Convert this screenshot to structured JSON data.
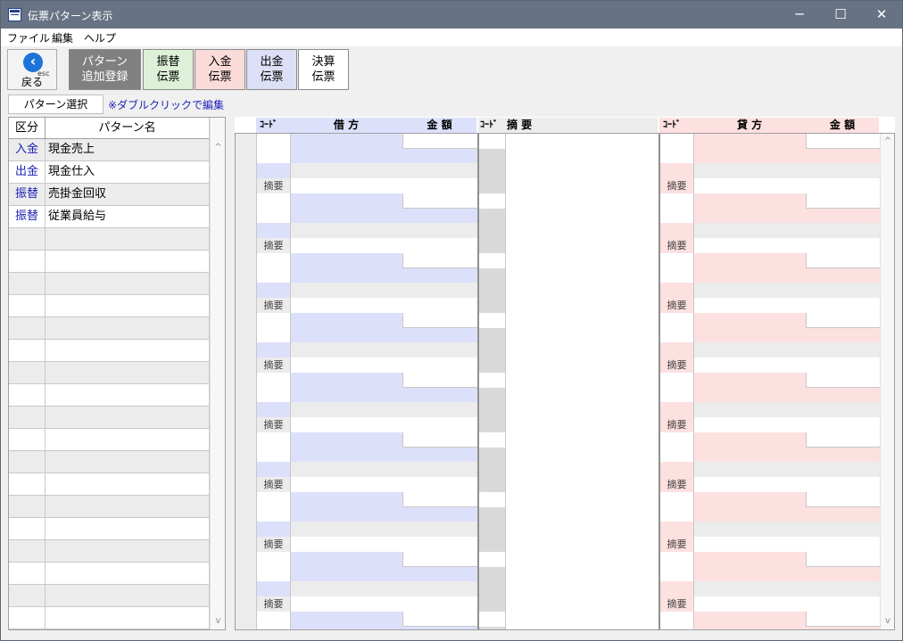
{
  "window": {
    "title": "伝票パターン表示",
    "minimize": "─",
    "maximize": "☐",
    "close": "✕"
  },
  "menu": [
    "ファイル",
    "編集",
    "ヘルプ"
  ],
  "toolbar": {
    "back": {
      "label": "戻る",
      "icon": "back-arrow-icon",
      "hint": "esc"
    },
    "add": {
      "line1": "パターン",
      "line2": "追加登録"
    },
    "furikae": {
      "line1": "振替",
      "line2": "伝票"
    },
    "nyukin": {
      "line1": "入金",
      "line2": "伝票"
    },
    "shukkin": {
      "line1": "出金",
      "line2": "伝票"
    },
    "kessan": {
      "line1": "決算",
      "line2": "伝票"
    }
  },
  "pattern_select_label": "パターン選択",
  "dblclick_note": "※ダブルクリックで編集",
  "left_grid": {
    "headers": [
      "区分",
      "パターン名"
    ],
    "rows": [
      {
        "kind": "入金",
        "name": "現金売上"
      },
      {
        "kind": "出金",
        "name": "現金仕入"
      },
      {
        "kind": "振替",
        "name": "売掛金回収"
      },
      {
        "kind": "振替",
        "name": "従業員給与"
      }
    ]
  },
  "journal_headers": {
    "debit_code": "ｺｰﾄﾞ",
    "debit": "借 方",
    "debit_amount": "金 額",
    "memo_code": "ｺｰﾄﾞ",
    "memo": "摘 要",
    "credit_code": "ｺｰﾄﾞ",
    "credit": "貸 方",
    "credit_amount": "金 額"
  },
  "memo_label": "摘要",
  "colors": {
    "titlebar": "#677384",
    "debit": "#dde0fa",
    "credit": "#fde0e0",
    "link": "#1e22b4"
  }
}
